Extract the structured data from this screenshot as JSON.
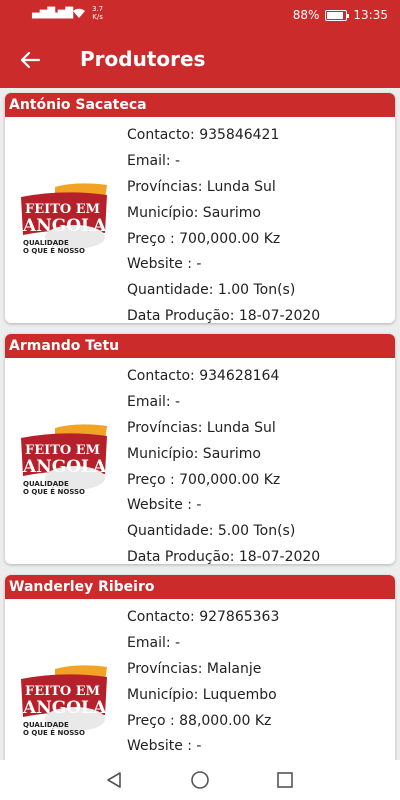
{
  "status_bar": {
    "signal1": "▄▆█",
    "signal2": "▄▆█",
    "net_speed": "3.7",
    "net_unit": "K/s",
    "battery": "88%",
    "battery_level": 0.88,
    "time": "13:35"
  },
  "app_bar": {
    "title": "Produtores",
    "back_icon": "arrow-left-icon"
  },
  "logo": {
    "line1": "FEITO EM",
    "line2": "ANGOLA",
    "tagline1": "QUALIDADE",
    "tagline2": "O QUE É NOSSO"
  },
  "producers": [
    {
      "name": "António Sacateca",
      "contacto": "Contacto: 935846421",
      "email": "Email: -",
      "provincias": "Províncias: Lunda Sul",
      "municipio": "Município: Saurimo",
      "preco": "Preço : 700,000.00 Kz",
      "website": "Website : -",
      "quantidade": "Quantidade: 1.00 Ton(s)",
      "data": "Data Produção: 18-07-2020"
    },
    {
      "name": "Armando Tetu",
      "contacto": "Contacto: 934628164",
      "email": "Email: -",
      "provincias": "Províncias: Lunda Sul",
      "municipio": "Município: Saurimo",
      "preco": "Preço : 700,000.00 Kz",
      "website": "Website : -",
      "quantidade": "Quantidade: 5.00 Ton(s)",
      "data": "Data Produção: 18-07-2020"
    },
    {
      "name": "Wanderley Ribeiro",
      "contacto": "Contacto: 927865363",
      "email": "Email: -",
      "provincias": "Províncias: Malanje",
      "municipio": "Município: Luquembo",
      "preco": "Preço : 88,000.00 Kz",
      "website": "Website : -"
    }
  ],
  "nav_bar": {
    "back": "triangle-back-icon",
    "home": "circle-home-icon",
    "recents": "square-recents-icon"
  },
  "colors": {
    "primary": "#cc2b2b",
    "background": "#ededed"
  }
}
